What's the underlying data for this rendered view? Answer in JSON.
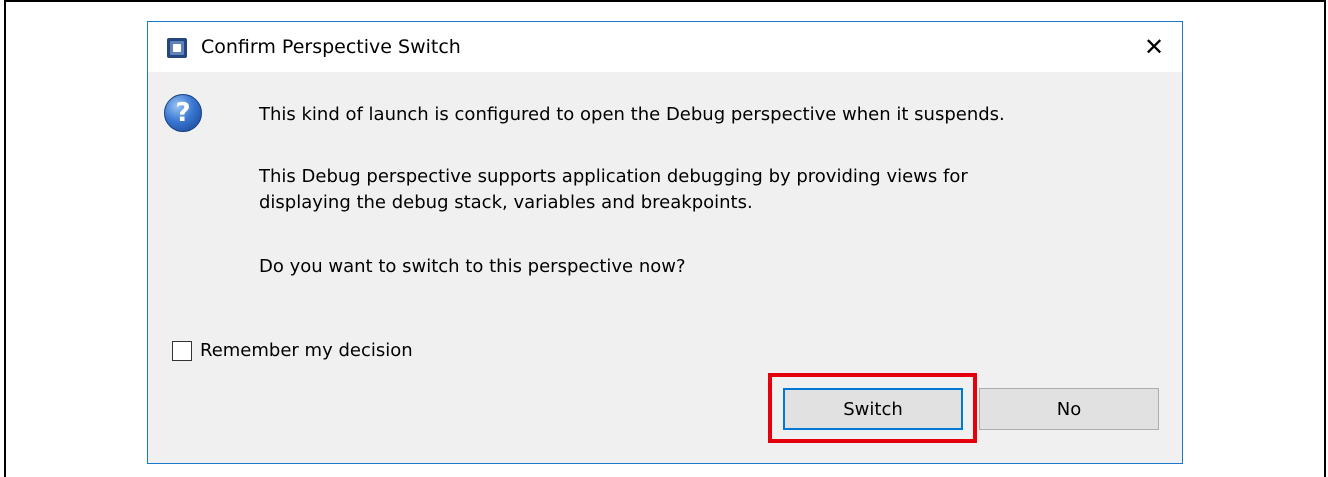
{
  "dialog": {
    "title": "Confirm Perspective Switch",
    "close_glyph": "✕",
    "icon": "eclipse-app-icon",
    "question_glyph": "?",
    "message_1": "This kind of launch is configured to open the Debug perspective when it suspends.",
    "message_2_line_1": "This Debug perspective supports application debugging by providing views for",
    "message_2_line_2": "displaying the debug stack, variables and breakpoints.",
    "message_3": "Do you want to switch to this perspective now?",
    "remember_label": "Remember my decision",
    "remember_checked": false,
    "switch_label": "Switch",
    "no_label": "No"
  },
  "colors": {
    "dialog_border": "#1979ca",
    "highlight": "#e5000b",
    "default_button_border": "#0078d7",
    "dialog_bg": "#f0f0f0"
  }
}
